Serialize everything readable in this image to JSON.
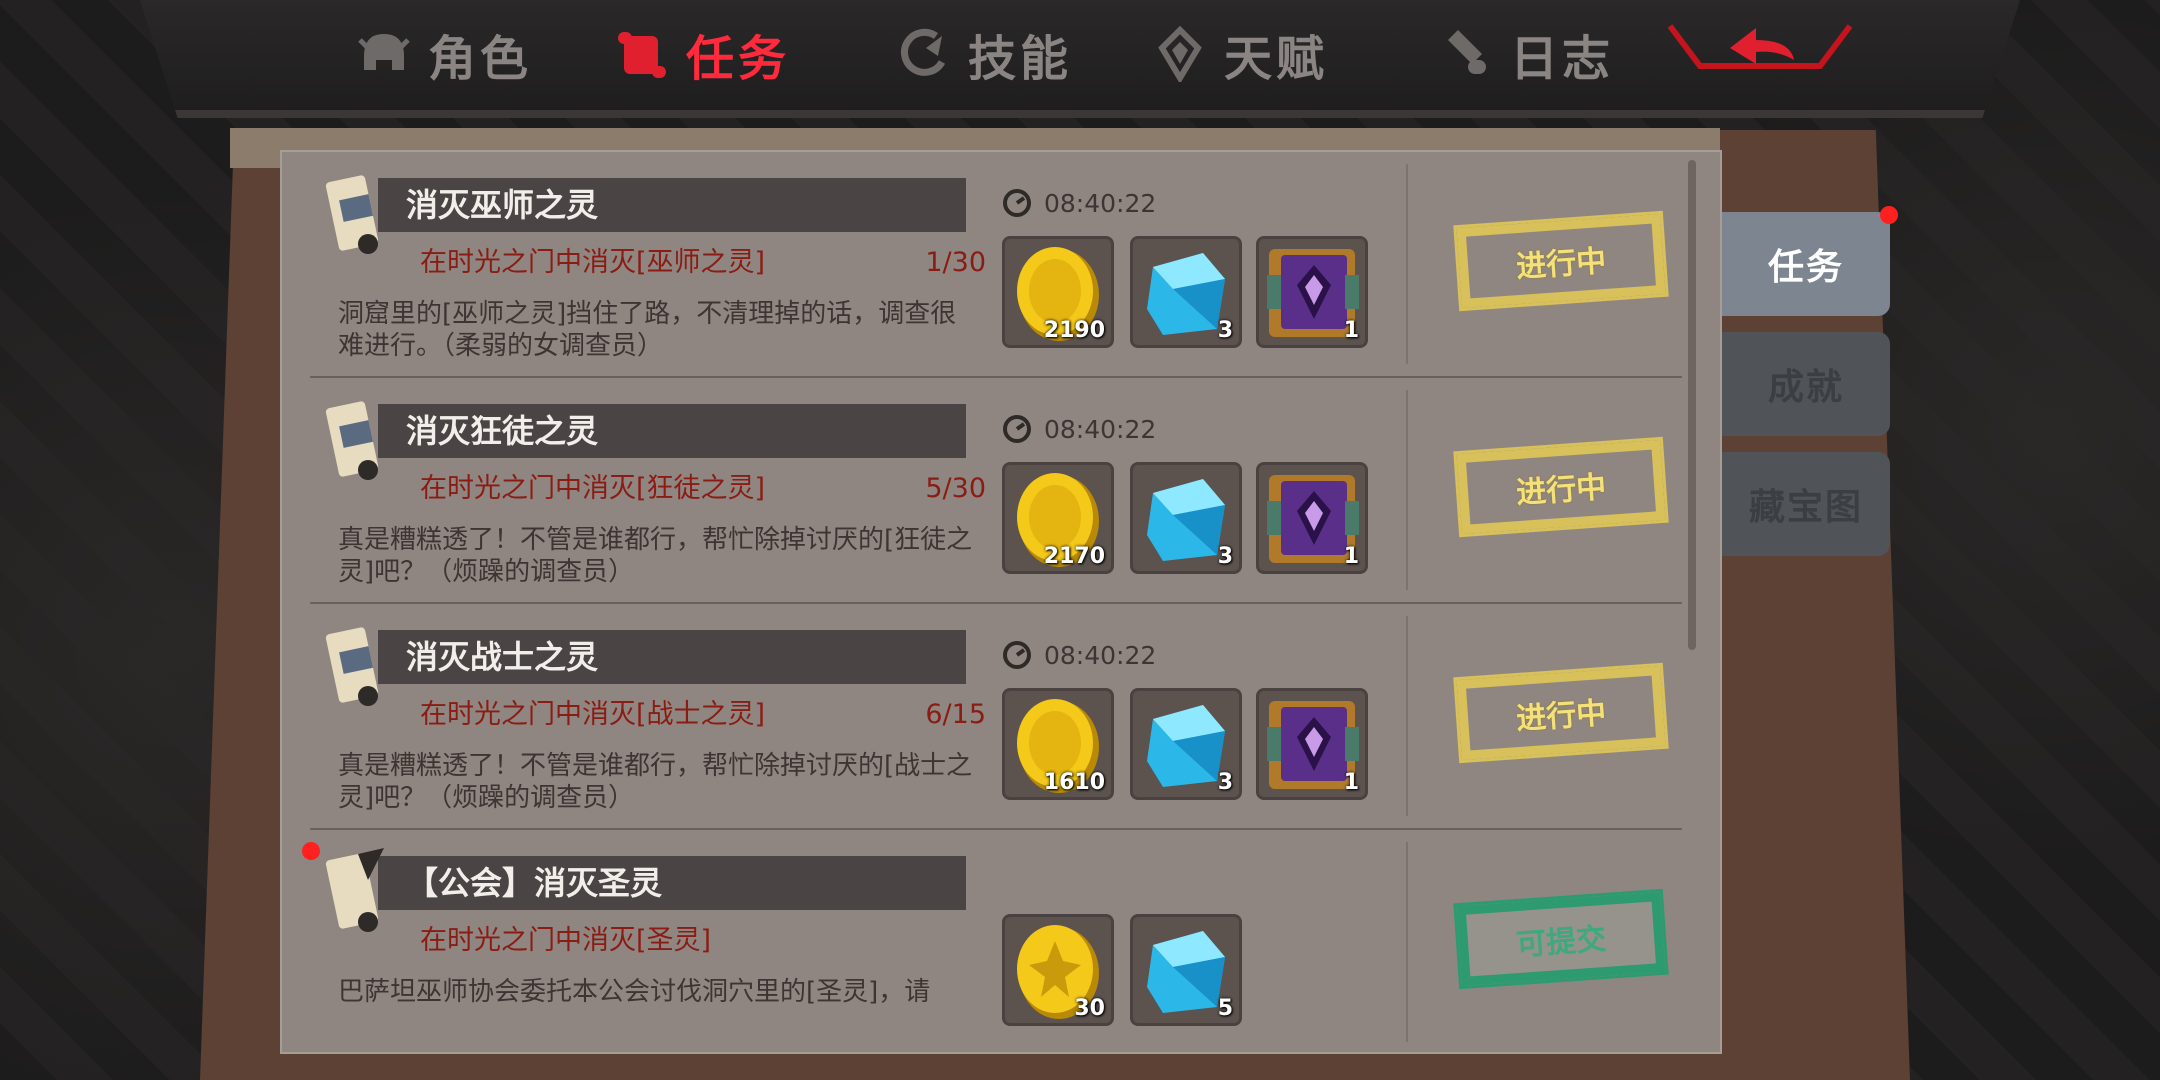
{
  "tabs": [
    {
      "label": "角色",
      "icon": "helmet-icon",
      "active": false
    },
    {
      "label": "任务",
      "icon": "scroll-icon",
      "active": true
    },
    {
      "label": "技能",
      "icon": "skill-icon",
      "active": false
    },
    {
      "label": "天赋",
      "icon": "talent-icon",
      "active": false
    },
    {
      "label": "日志",
      "icon": "scroll-log-icon",
      "active": false
    }
  ],
  "back_icon": "back-arrow-icon",
  "side_tabs": [
    {
      "label": "任务",
      "active": true
    },
    {
      "label": "成就",
      "active": false
    },
    {
      "label": "藏宝图",
      "active": false
    }
  ],
  "quests": [
    {
      "title": "消灭巫师之灵",
      "objective": "在时光之门中消灭[巫师之灵]",
      "progress": "1/30",
      "description": "洞窟里的[巫师之灵]挡住了路，不清理掉的话，调查很难进行。（柔弱的女调查员）",
      "timer": "08:40:22",
      "rewards": [
        {
          "icon": "gold-coin-icon",
          "count": "2190"
        },
        {
          "icon": "blue-crystal-icon",
          "count": "3"
        },
        {
          "icon": "spell-book-icon",
          "count": "1"
        }
      ],
      "status": "进行中"
    },
    {
      "title": "消灭狂徒之灵",
      "objective": "在时光之门中消灭[狂徒之灵]",
      "progress": "5/30",
      "description": "真是糟糕透了！不管是谁都行，帮忙除掉讨厌的[狂徒之灵]吧？（烦躁的调查员）",
      "timer": "08:40:22",
      "rewards": [
        {
          "icon": "gold-coin-icon",
          "count": "2170"
        },
        {
          "icon": "blue-crystal-icon",
          "count": "3"
        },
        {
          "icon": "spell-book-icon",
          "count": "1"
        }
      ],
      "status": "进行中"
    },
    {
      "title": "消灭战士之灵",
      "objective": "在时光之门中消灭[战士之灵]",
      "progress": "6/15",
      "description": "真是糟糕透了！不管是谁都行，帮忙除掉讨厌的[战士之灵]吧？（烦躁的调查员）",
      "timer": "08:40:22",
      "rewards": [
        {
          "icon": "gold-coin-icon",
          "count": "1610"
        },
        {
          "icon": "blue-crystal-icon",
          "count": "3"
        },
        {
          "icon": "spell-book-icon",
          "count": "1"
        }
      ],
      "status": "进行中"
    },
    {
      "title": "【公会】消灭圣灵",
      "objective": "在时光之门中消灭[圣灵]",
      "progress": "",
      "description": "巴萨坦巫师协会委托本公会讨伐洞穴里的[圣灵]，请",
      "timer": "",
      "rewards": [
        {
          "icon": "guild-coin-icon",
          "count": "30"
        },
        {
          "icon": "blue-crystal-icon",
          "count": "5"
        }
      ],
      "status": "可提交"
    }
  ],
  "colors": {
    "active_tab": "#ff2b3d",
    "objective_text": "#8a1c14",
    "in_progress": "#d8c05a",
    "submittable": "#2e9a70",
    "alert_dot": "#ff2020"
  }
}
